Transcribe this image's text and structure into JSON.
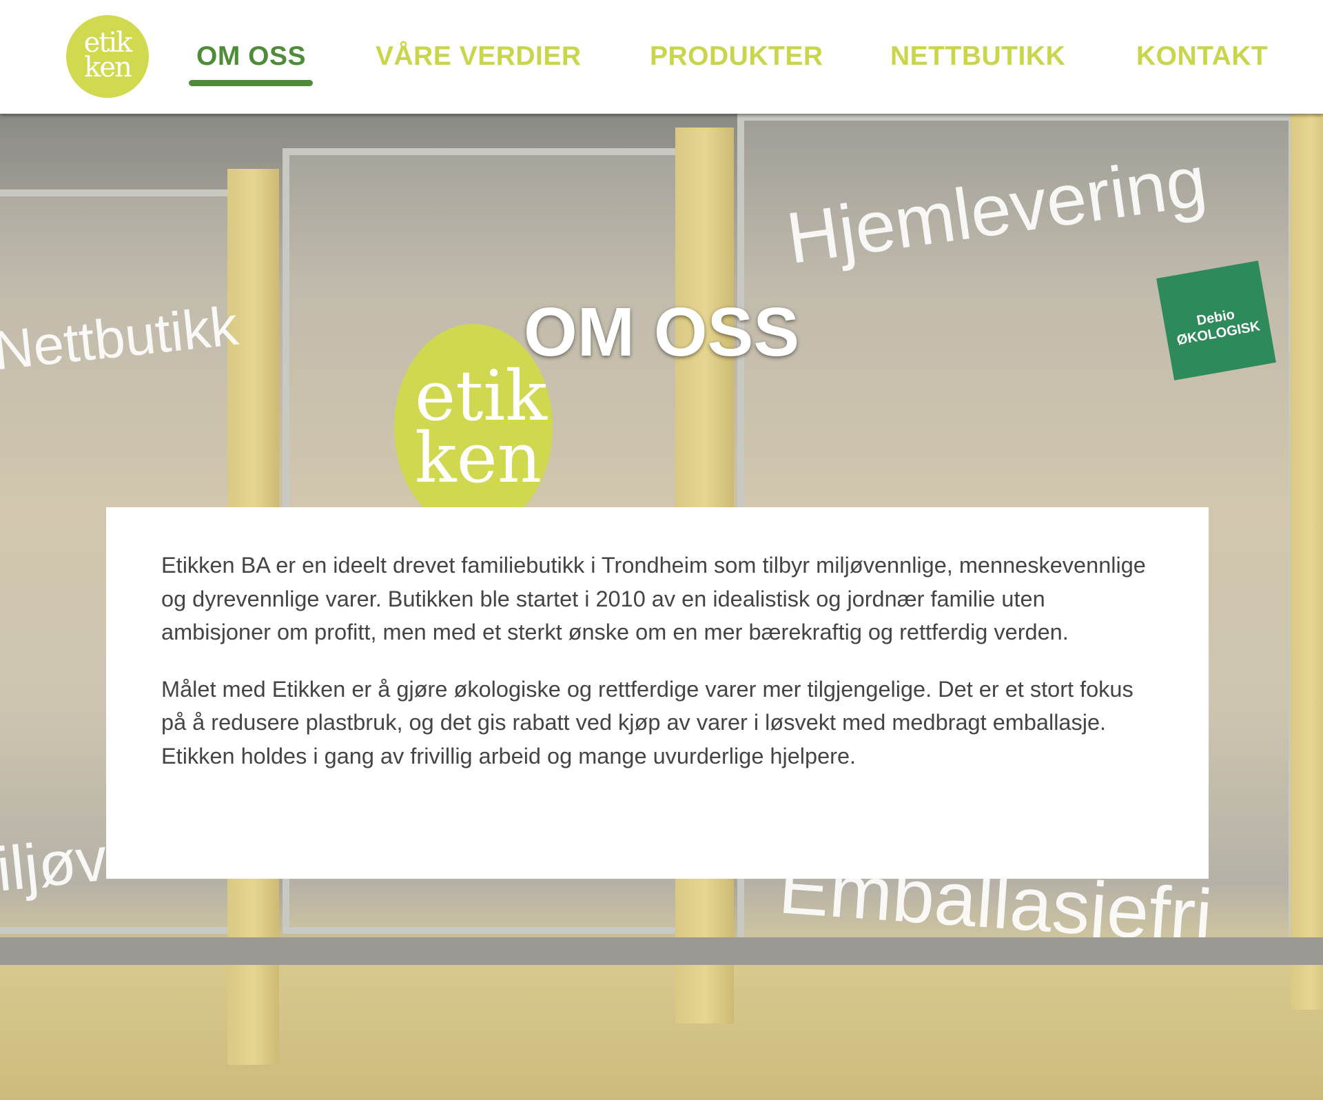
{
  "brand": {
    "logo_text_line1": "etik",
    "logo_text_line2": "ken",
    "accent_active": "#4e8c3a",
    "accent": "#c9d54b"
  },
  "nav": {
    "items": [
      {
        "label": "OM OSS",
        "active": true
      },
      {
        "label": "VÅRE VERDIER",
        "active": false
      },
      {
        "label": "PRODUKTER",
        "active": false
      },
      {
        "label": "NETTBUTIKK",
        "active": false
      },
      {
        "label": "KONTAKT",
        "active": false
      }
    ]
  },
  "hero": {
    "title": "OM OSS",
    "photo_signage": {
      "left": "Nettbutikk",
      "top_right": "Hjemlevering",
      "bottom_left": "miljøvennlig",
      "bottom_right": "Emballasjefri",
      "badge": "Debio ØKOLOGISK",
      "logo": "etikken"
    }
  },
  "about": {
    "paragraphs": [
      "Etikken BA er en ideelt drevet familiebutikk i Trondheim som tilbyr miljøvennlige, menneskevennlige og dyrevennlige varer. Butikken ble startet i 2010 av en idealistisk og jordnær familie uten ambisjoner om profitt, men med et sterkt ønske om en mer bærekraftig og rettferdig verden.",
      "Målet med Etikken er å gjøre økologiske og rettferdige varer mer tilgjengelige. Det er et stort fokus på å redusere plastbruk, og det gis rabatt ved kjøp av varer i løsvekt med medbragt emballasje. Etikken holdes i gang av frivillig arbeid og mange uvurderlige hjelpere."
    ]
  }
}
